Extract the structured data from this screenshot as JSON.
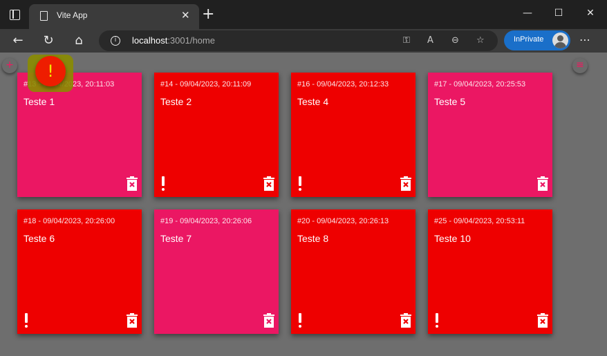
{
  "browser": {
    "tab_title": "Vite App",
    "tab_close": "✕",
    "new_tab": "+",
    "url_host": "localhost",
    "url_rest": ":3001/home",
    "inprivate_label": "InPrivate",
    "menu_dots": "⋯",
    "window_controls": {
      "minimize": "—",
      "maximize": "☐",
      "close": "✕"
    },
    "nav": {
      "back": "←",
      "refresh": "↻",
      "home": "⌂"
    },
    "address_icons": {
      "key": "⚿",
      "read_aloud": "A",
      "zoom_out": "⊖",
      "favorites": "☆"
    }
  },
  "page": {
    "add_button": "+",
    "right_button": "≡",
    "alert_icon": "!",
    "notes": [
      {
        "meta": "#13 - 09/04/2023, 20:11:03",
        "title": "Teste 1",
        "priority": "normal"
      },
      {
        "meta": "#14 - 09/04/2023, 20:11:09",
        "title": "Teste 2",
        "priority": "urgent"
      },
      {
        "meta": "#16 - 09/04/2023, 20:12:33",
        "title": "Teste 4",
        "priority": "urgent"
      },
      {
        "meta": "#17 - 09/04/2023, 20:25:53",
        "title": "Teste 5",
        "priority": "normal"
      },
      {
        "meta": "#18 - 09/04/2023, 20:26:00",
        "title": "Teste 6",
        "priority": "urgent"
      },
      {
        "meta": "#19 - 09/04/2023, 20:26:06",
        "title": "Teste 7",
        "priority": "normal"
      },
      {
        "meta": "#20 - 09/04/2023, 20:26:13",
        "title": "Teste 8",
        "priority": "urgent"
      },
      {
        "meta": "#25 - 09/04/2023, 20:53:11",
        "title": "Teste 10",
        "priority": "urgent"
      }
    ]
  },
  "colors": {
    "normal_note": "#eb1763",
    "urgent_note": "#ee0000",
    "background": "#6e6e6e",
    "alert_bubble": "#ee1d00",
    "inprivate": "#1a6fc9"
  }
}
